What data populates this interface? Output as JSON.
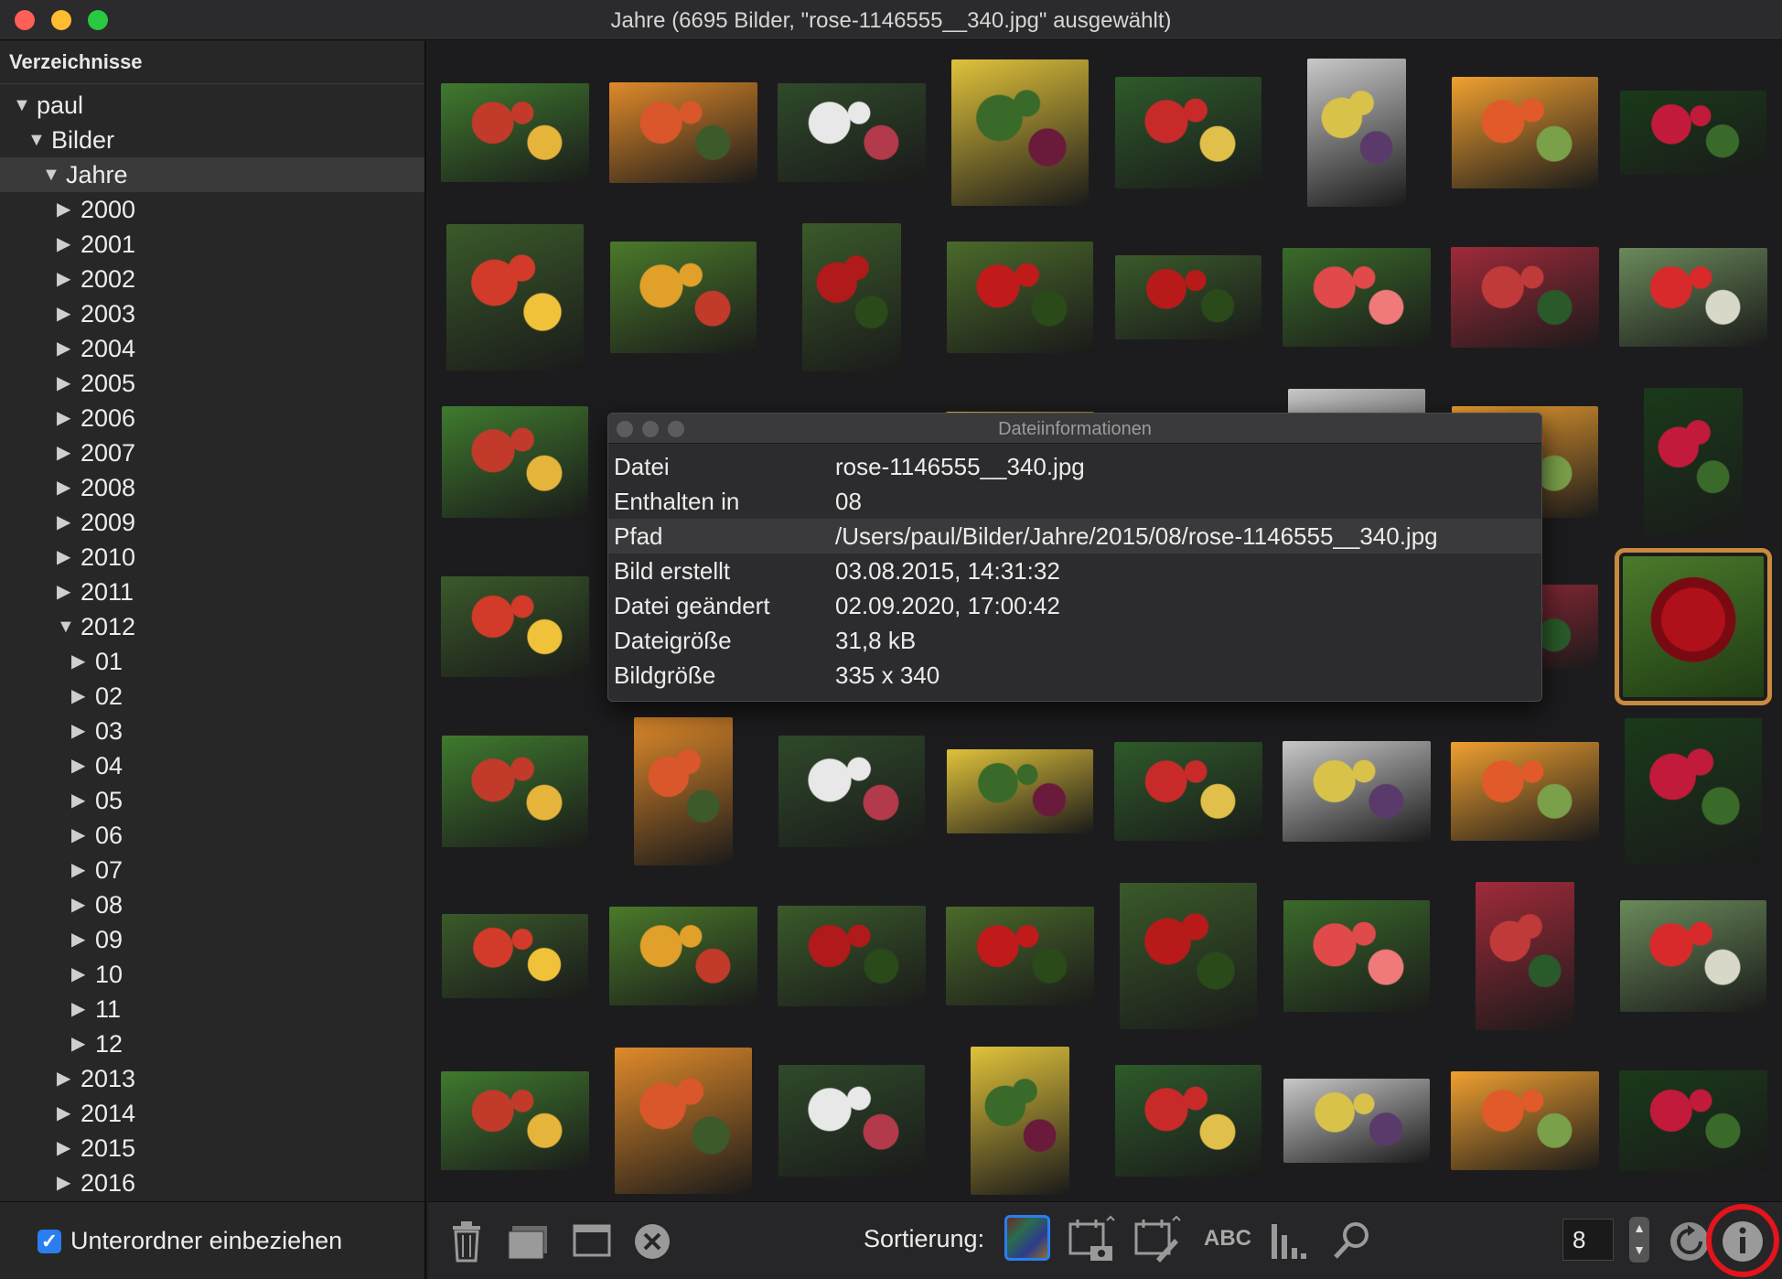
{
  "window": {
    "title": "Jahre (6695 Bilder, \"rose-1146555__340.jpg\" ausgewählt)"
  },
  "sidebar": {
    "header": "Verzeichnisse",
    "tree": [
      {
        "label": "paul",
        "expanded": true
      },
      {
        "label": "Bilder",
        "expanded": true
      },
      {
        "label": "Jahre",
        "expanded": true,
        "selected": true
      },
      {
        "label": "2000"
      },
      {
        "label": "2001"
      },
      {
        "label": "2002"
      },
      {
        "label": "2003"
      },
      {
        "label": "2004"
      },
      {
        "label": "2005"
      },
      {
        "label": "2006"
      },
      {
        "label": "2007"
      },
      {
        "label": "2008"
      },
      {
        "label": "2009"
      },
      {
        "label": "2010"
      },
      {
        "label": "2011"
      },
      {
        "label": "2012",
        "expanded": true
      },
      {
        "label": "01"
      },
      {
        "label": "02"
      },
      {
        "label": "03"
      },
      {
        "label": "04"
      },
      {
        "label": "05"
      },
      {
        "label": "06"
      },
      {
        "label": "07"
      },
      {
        "label": "08"
      },
      {
        "label": "09"
      },
      {
        "label": "10"
      },
      {
        "label": "11"
      },
      {
        "label": "12"
      },
      {
        "label": "2013"
      },
      {
        "label": "2014"
      },
      {
        "label": "2015"
      },
      {
        "label": "2016"
      }
    ],
    "subfolder_checkbox": {
      "label": "Unterordner einbeziehen",
      "checked": true
    }
  },
  "toolbar": {
    "sort_label": "Sortierung:",
    "columns_value": "8",
    "icons": [
      "trash-icon",
      "folder-icon",
      "window-icon",
      "close-circle-icon",
      "sort-color-icon",
      "sort-date-taken-icon",
      "sort-date-modified-icon",
      "sort-name-icon",
      "sort-size-icon",
      "search-icon",
      "refresh-icon",
      "info-icon"
    ],
    "sort_name_text": "ABC",
    "highlight_color": "#e2141c"
  },
  "info_panel": {
    "title": "Dateiinformationen",
    "rows": [
      {
        "key": "Datei",
        "value": "rose-1146555__340.jpg"
      },
      {
        "key": "Enthalten in",
        "value": "08"
      },
      {
        "key": "Pfad",
        "value": "/Users/paul/Bilder/Jahre/2015/08/rose-1146555__340.jpg"
      },
      {
        "key": "Bild erstellt",
        "value": "03.08.2015, 14:31:32"
      },
      {
        "key": "Datei geändert",
        "value": "02.09.2020, 17:00:42"
      },
      {
        "key": "Dateigröße",
        "value": "31,8 kB"
      },
      {
        "key": "Bildgröße",
        "value": "335 x 340"
      }
    ]
  },
  "accent_colors": {
    "selection": "#c98a3e",
    "checkbox": "#2a7ef0"
  }
}
